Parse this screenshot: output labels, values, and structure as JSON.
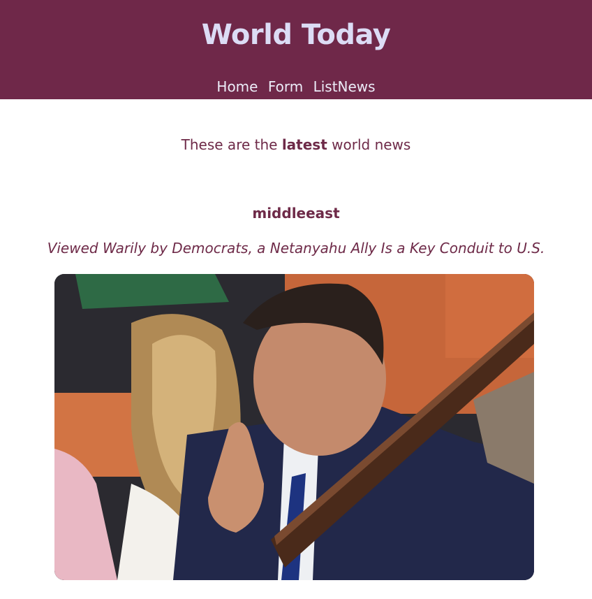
{
  "site": {
    "title": "World Today"
  },
  "nav": [
    {
      "label": "Home"
    },
    {
      "label": "Form"
    },
    {
      "label": "ListNews"
    }
  ],
  "intro": {
    "prefix": "These are the ",
    "emphasis": "latest",
    "suffix": " world news"
  },
  "article": {
    "category": "middleeast",
    "headline": "Viewed Warily by Democrats, a Netanyahu Ally Is a Key Conduit to U.S."
  },
  "colors": {
    "header_bg": "#6f2849",
    "accent_text": "#6e2a48",
    "title_text": "#dcdcf5"
  }
}
